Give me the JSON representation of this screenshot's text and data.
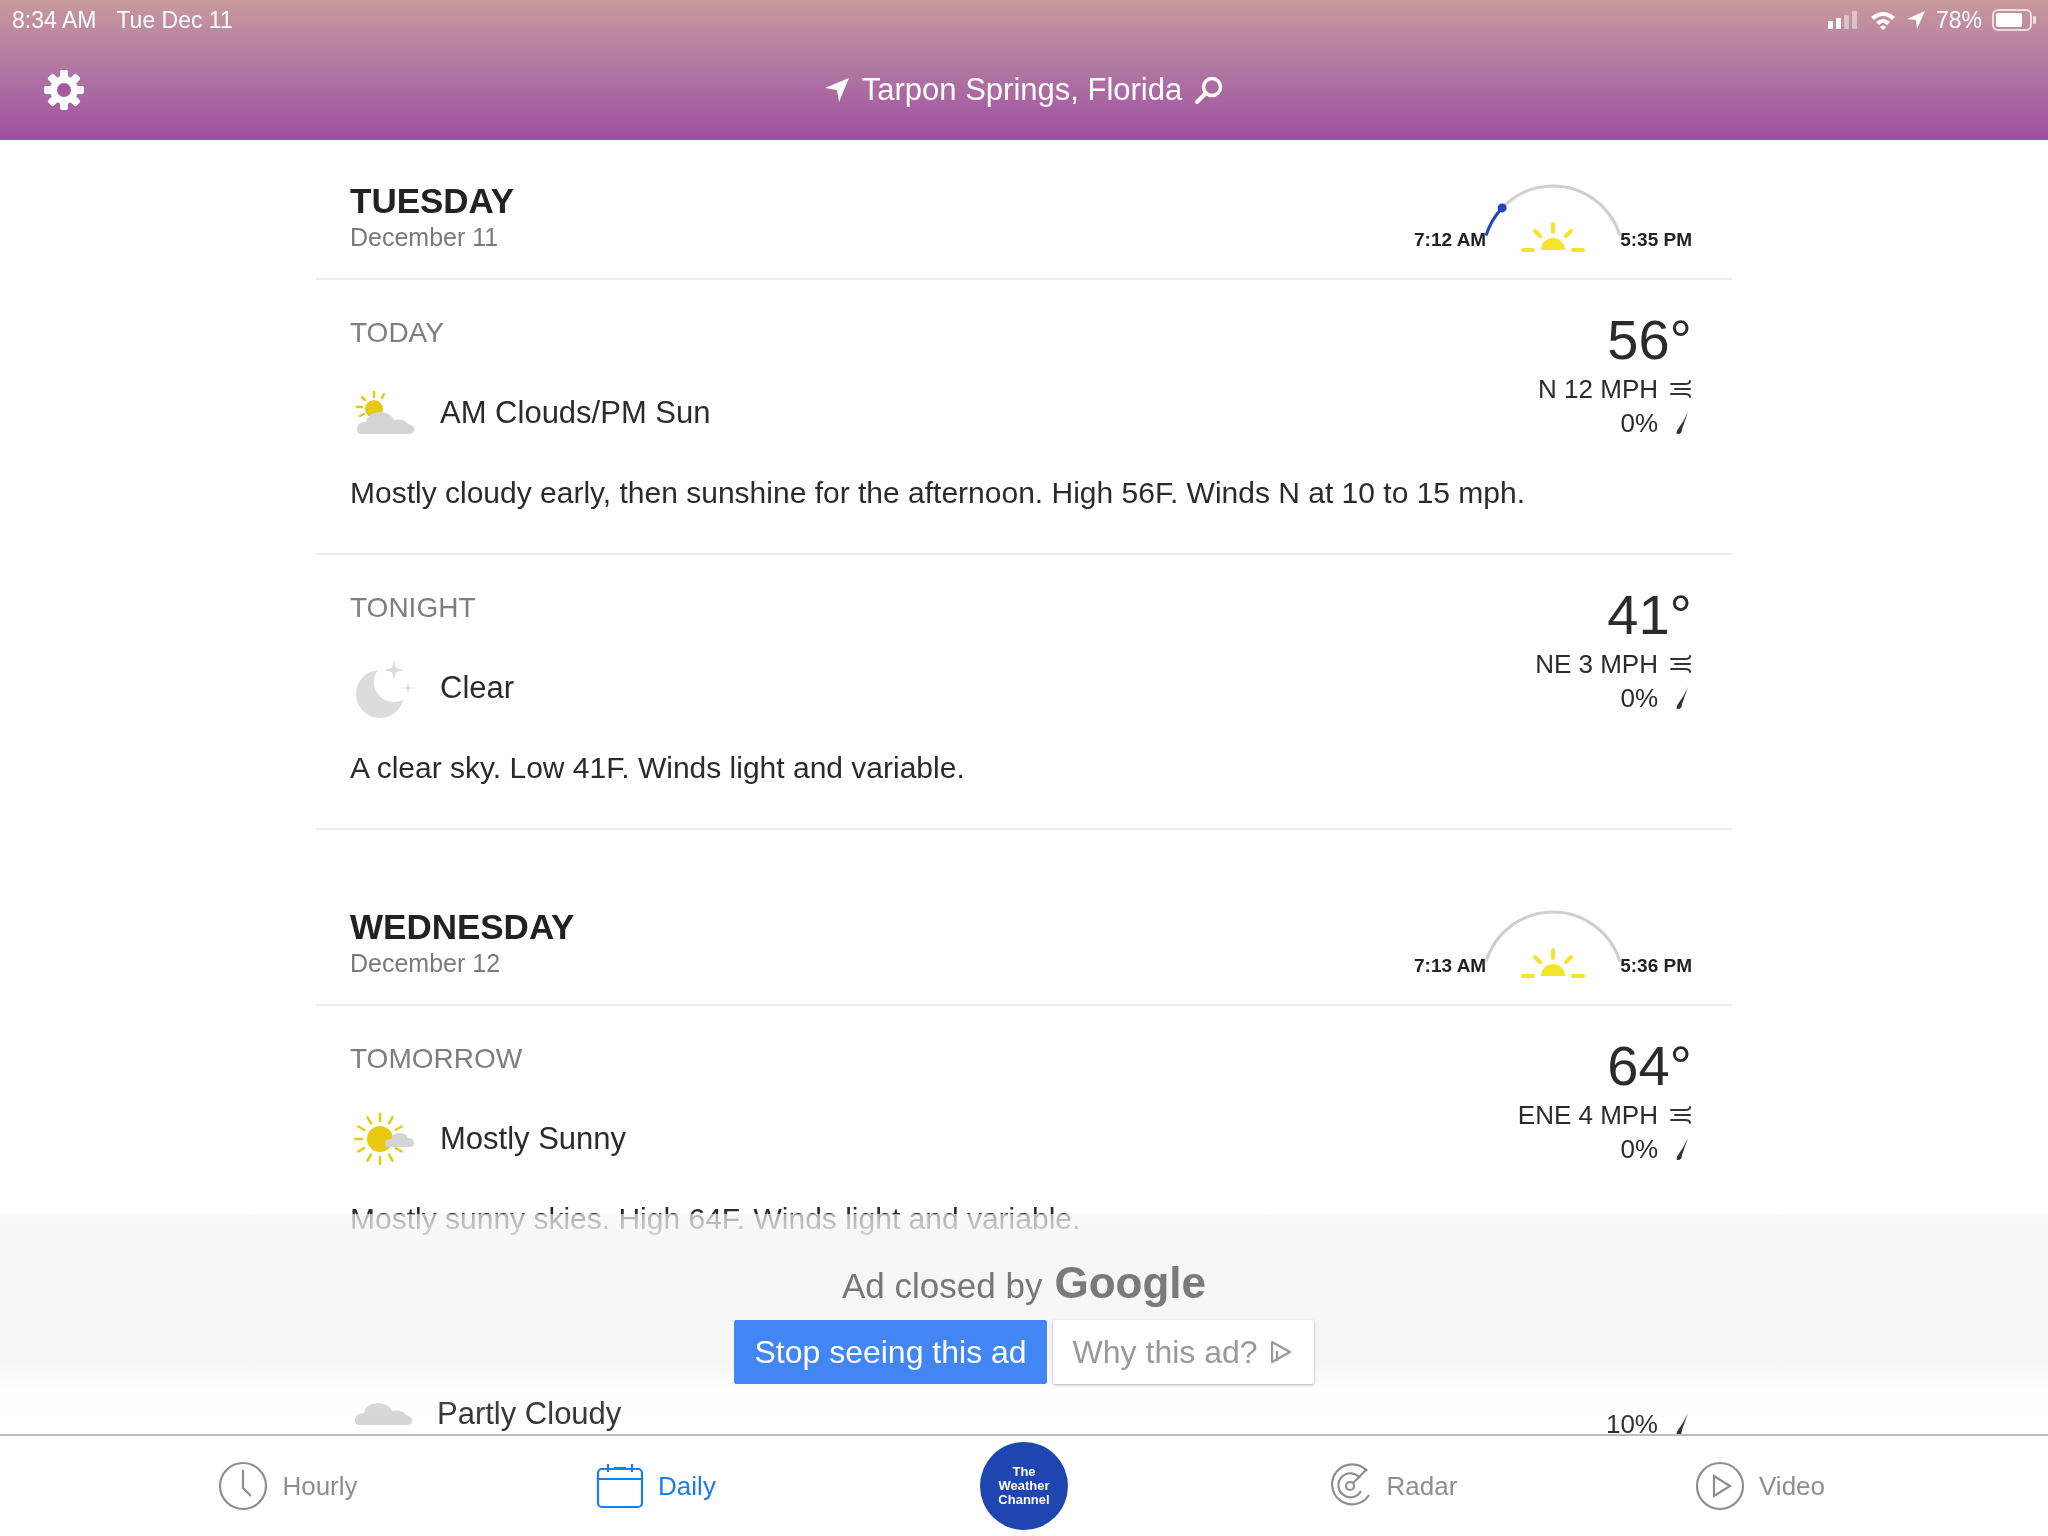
{
  "status_bar": {
    "time": "8:34 AM",
    "date": "Tue Dec 11",
    "battery": "78%"
  },
  "header": {
    "location": "Tarpon Springs, Florida"
  },
  "days": [
    {
      "day": "TUESDAY",
      "date": "December 11",
      "sunrise": "7:12 AM",
      "sunset": "5:35 PM",
      "sun": {
        "level": 0.12
      },
      "periods": [
        {
          "label": "TODAY",
          "kind": "partly-sunny",
          "condition": "AM Clouds/PM Sun",
          "temperature": "56°",
          "wind": "N 12 MPH",
          "precip": "0%",
          "description": "Mostly cloudy early, then sunshine for the afternoon. High 56F. Winds N at 10 to 15 mph."
        },
        {
          "label": "TONIGHT",
          "kind": "moon",
          "condition": "Clear",
          "temperature": "41°",
          "wind": "NE 3 MPH",
          "precip": "0%",
          "description": "A clear sky. Low 41F. Winds light and variable."
        }
      ]
    },
    {
      "day": "WEDNESDAY",
      "date": "December 12",
      "sunrise": "7:13 AM",
      "sunset": "5:36 PM",
      "periods": [
        {
          "label": "TOMORROW",
          "kind": "mostly-sunny",
          "condition": "Mostly Sunny",
          "temperature": "64°",
          "wind": "ENE 4 MPH",
          "precip": "0%",
          "description": "Mostly sunny skies. High 64F. Winds light and variable."
        },
        {
          "kind": "partly-cloudy",
          "condition": "Partly Cloudy",
          "precip": "10%"
        }
      ]
    }
  ],
  "ad": {
    "text": "Ad closed by",
    "brand": "Google",
    "buttons": [
      {
        "kind": "primary",
        "label": "Stop seeing this ad"
      },
      {
        "kind": "secondary",
        "label": "Why this ad?"
      }
    ]
  },
  "tab_bar": [
    {
      "kind": "clock",
      "label": "Hourly",
      "selected": false
    },
    {
      "kind": "calendar",
      "label": "Daily",
      "selected": true
    },
    {
      "kind": "logo",
      "label": "The Weather Channel",
      "selected": false
    },
    {
      "kind": "radar",
      "label": "Radar",
      "selected": false
    },
    {
      "kind": "play",
      "label": "Video",
      "selected": false
    }
  ]
}
